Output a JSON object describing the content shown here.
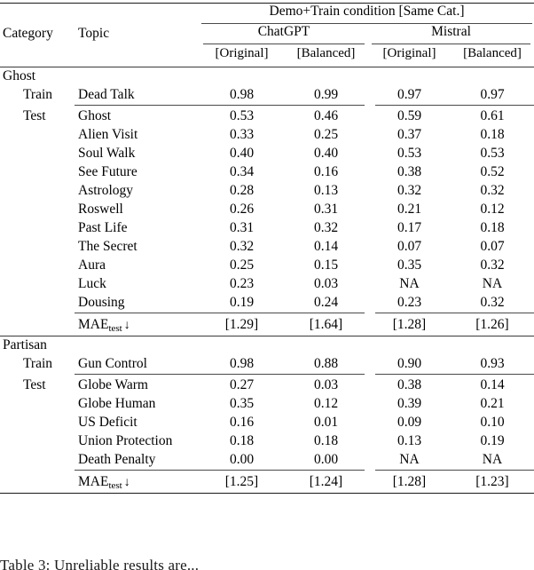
{
  "table": {
    "header": {
      "stub_category": "Category",
      "stub_topic": "Topic",
      "condition_span": "Demo+Train condition [Same Cat.]",
      "model_groups": [
        {
          "name": "ChatGPT",
          "columns": [
            "[Original]",
            "[Balanced]"
          ]
        },
        {
          "name": "Mistral",
          "columns": [
            "[Original]",
            "[Balanced]"
          ]
        }
      ]
    },
    "sections": [
      {
        "category": "Ghost",
        "train_label": "Train",
        "test_label": "Test",
        "train_rows": [
          {
            "topic": "Dead Talk",
            "values": [
              "0.98",
              "0.99",
              "0.97",
              "0.97"
            ]
          }
        ],
        "test_rows": [
          {
            "topic": "Ghost",
            "values": [
              "0.53",
              "0.46",
              "0.59",
              "0.61"
            ]
          },
          {
            "topic": "Alien Visit",
            "values": [
              "0.33",
              "0.25",
              "0.37",
              "0.18"
            ]
          },
          {
            "topic": "Soul Walk",
            "values": [
              "0.40",
              "0.40",
              "0.53",
              "0.53"
            ]
          },
          {
            "topic": "See Future",
            "values": [
              "0.34",
              "0.16",
              "0.38",
              "0.52"
            ]
          },
          {
            "topic": "Astrology",
            "values": [
              "0.28",
              "0.13",
              "0.32",
              "0.32"
            ]
          },
          {
            "topic": "Roswell",
            "values": [
              "0.26",
              "0.31",
              "0.21",
              "0.12"
            ]
          },
          {
            "topic": "Past Life",
            "values": [
              "0.31",
              "0.32",
              "0.17",
              "0.18"
            ]
          },
          {
            "topic": "The Secret",
            "values": [
              "0.32",
              "0.14",
              "0.07",
              "0.07"
            ]
          },
          {
            "topic": "Aura",
            "values": [
              "0.25",
              "0.15",
              "0.35",
              "0.32"
            ]
          },
          {
            "topic": "Luck",
            "values": [
              "0.23",
              "0.03",
              "NA",
              "NA"
            ]
          },
          {
            "topic": "Dousing",
            "values": [
              "0.19",
              "0.24",
              "0.23",
              "0.32"
            ]
          }
        ],
        "summary": {
          "label_main": "MAE",
          "label_sub": "test",
          "label_arrow": "↓",
          "values": [
            "[1.29]",
            "[1.64]",
            "[1.28]",
            "[1.26]"
          ]
        }
      },
      {
        "category": "Partisan",
        "train_label": "Train",
        "test_label": "Test",
        "train_rows": [
          {
            "topic": "Gun Control",
            "values": [
              "0.98",
              "0.88",
              "0.90",
              "0.93"
            ]
          }
        ],
        "test_rows": [
          {
            "topic": "Globe Warm",
            "values": [
              "0.27",
              "0.03",
              "0.38",
              "0.14"
            ]
          },
          {
            "topic": "Globe Human",
            "values": [
              "0.35",
              "0.12",
              "0.39",
              "0.21"
            ]
          },
          {
            "topic": "US Deficit",
            "values": [
              "0.16",
              "0.01",
              "0.09",
              "0.10"
            ]
          },
          {
            "topic": "Union Protection",
            "values": [
              "0.18",
              "0.18",
              "0.13",
              "0.19"
            ]
          },
          {
            "topic": "Death Penalty",
            "values": [
              "0.00",
              "0.00",
              "NA",
              "NA"
            ]
          }
        ],
        "summary": {
          "label_main": "MAE",
          "label_sub": "test",
          "label_arrow": "↓",
          "values": [
            "[1.25]",
            "[1.24]",
            "[1.28]",
            "[1.23]"
          ]
        }
      }
    ]
  },
  "caption": {
    "text": "Table 3:  Unreliable results are..."
  }
}
